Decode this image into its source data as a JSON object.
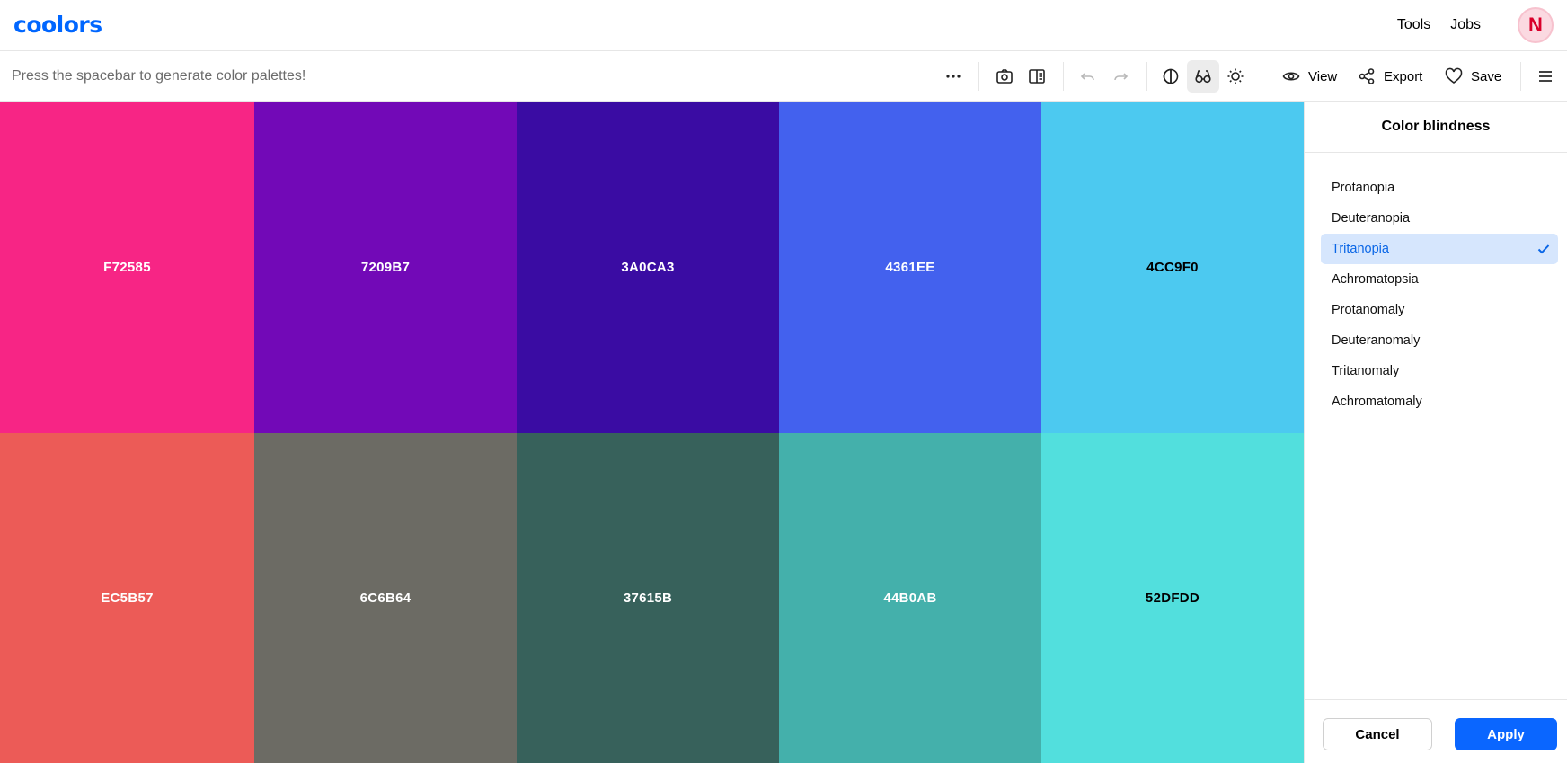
{
  "brand": {
    "logo_text": "coolors",
    "color": "#0066ff"
  },
  "topnav": {
    "links": [
      "Tools",
      "Jobs"
    ],
    "avatar_initial": "N"
  },
  "toolbar": {
    "hint": "Press the spacebar to generate color palettes!",
    "view_label": "View",
    "export_label": "Export",
    "save_label": "Save",
    "icons": [
      "more-icon",
      "camera-icon",
      "columns-icon",
      "undo-icon",
      "redo-icon",
      "contrast-icon",
      "glasses-icon",
      "brightness-icon",
      "eye-icon",
      "share-icon",
      "heart-icon",
      "menu-icon"
    ]
  },
  "palette": {
    "top": [
      {
        "hex": "F72585",
        "color": "#F72585",
        "text_color": "#ffffff"
      },
      {
        "hex": "7209B7",
        "color": "#7209B7",
        "text_color": "#ffffff"
      },
      {
        "hex": "3A0CA3",
        "color": "#3A0CA3",
        "text_color": "#ffffff"
      },
      {
        "hex": "4361EE",
        "color": "#4361EE",
        "text_color": "#ffffff"
      },
      {
        "hex": "4CC9F0",
        "color": "#4CC9F0",
        "text_color": "#000000"
      }
    ],
    "bottom": [
      {
        "hex": "EC5B57",
        "color": "#EC5B57",
        "text_color": "#ffffff"
      },
      {
        "hex": "6C6B64",
        "color": "#6C6B64",
        "text_color": "#ffffff"
      },
      {
        "hex": "37615B",
        "color": "#37615B",
        "text_color": "#ffffff"
      },
      {
        "hex": "44B0AB",
        "color": "#44B0AB",
        "text_color": "#ffffff"
      },
      {
        "hex": "52DFDD",
        "color": "#52DFDD",
        "text_color": "#000000"
      }
    ]
  },
  "panel": {
    "title": "Color blindness",
    "options": [
      {
        "label": "Protanopia",
        "selected": false
      },
      {
        "label": "Deuteranopia",
        "selected": false
      },
      {
        "label": "Tritanopia",
        "selected": true
      },
      {
        "label": "Achromatopsia",
        "selected": false
      },
      {
        "label": "Protanomaly",
        "selected": false
      },
      {
        "label": "Deuteranomaly",
        "selected": false
      },
      {
        "label": "Tritanomaly",
        "selected": false
      },
      {
        "label": "Achromatomaly",
        "selected": false
      }
    ],
    "cancel_label": "Cancel",
    "apply_label": "Apply"
  }
}
